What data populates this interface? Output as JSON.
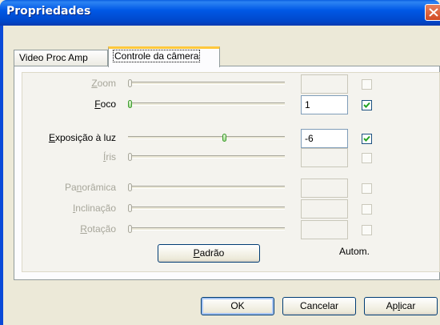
{
  "window": {
    "title": "Propriedades",
    "close_icon": "close-icon"
  },
  "tabs": [
    {
      "label": "Video Proc Amp",
      "active": false
    },
    {
      "label": "Controle da câmera",
      "active": true
    }
  ],
  "controls": [
    {
      "key": "zoom",
      "label_pre": "",
      "label_u": "Z",
      "label_post": "oom",
      "enabled": false,
      "level": 0.0,
      "value": "",
      "auto": false
    },
    {
      "key": "foco",
      "label_pre": "",
      "label_u": "F",
      "label_post": "oco",
      "enabled": true,
      "level": 0.0,
      "value": "1",
      "auto": true
    },
    {
      "key": "exposicao",
      "label_pre": "",
      "label_u": "E",
      "label_post": "xposição à luz",
      "enabled": true,
      "level": 0.6,
      "value": "-6",
      "auto": true
    },
    {
      "key": "iris",
      "label_pre": "",
      "label_u": "Í",
      "label_post": "ris",
      "enabled": false,
      "level": 0.0,
      "value": "",
      "auto": false
    },
    {
      "key": "panoramica",
      "label_pre": "Pa",
      "label_u": "n",
      "label_post": "orâmica",
      "enabled": false,
      "level": 0.0,
      "value": "",
      "auto": false
    },
    {
      "key": "inclinacao",
      "label_pre": "",
      "label_u": "I",
      "label_post": "nclinação",
      "enabled": false,
      "level": 0.0,
      "value": "",
      "auto": false
    },
    {
      "key": "rotacao",
      "label_pre": "",
      "label_u": "R",
      "label_post": "otação",
      "enabled": false,
      "level": 0.0,
      "value": "",
      "auto": false
    }
  ],
  "default_button": {
    "pre": "",
    "u": "P",
    "post": "adrão"
  },
  "auto_label": "Autom.",
  "footer": {
    "ok": {
      "pre": "",
      "u": "",
      "post": "OK"
    },
    "cancel": {
      "pre": "",
      "u": "",
      "post": "Cancelar"
    },
    "apply": {
      "pre": "Ap",
      "u": "l",
      "post": "icar"
    }
  },
  "colors": {
    "titlebar": "#0058e6",
    "tab_highlight": "#ffc83c",
    "dialog_bg": "#ece9d8",
    "check": "#21a121"
  }
}
